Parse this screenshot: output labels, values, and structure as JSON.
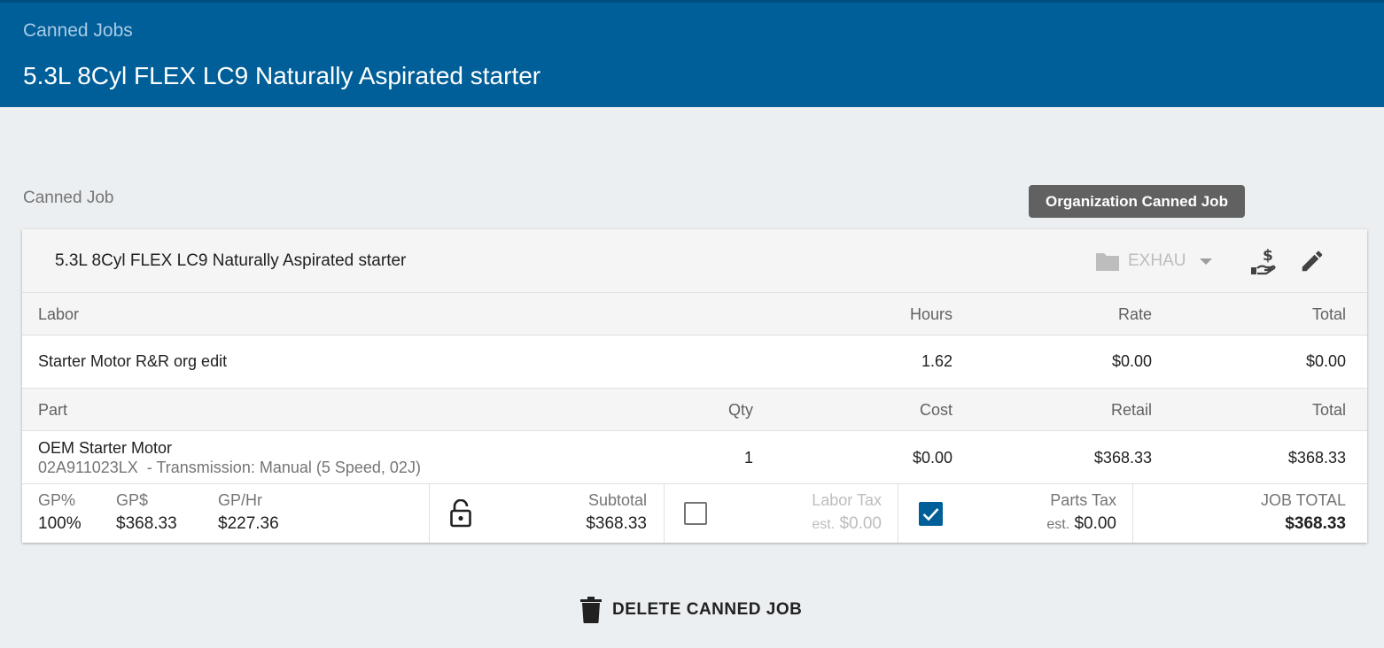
{
  "header": {
    "breadcrumb": "Canned Jobs",
    "title": "5.3L 8Cyl FLEX LC9 Naturally Aspirated starter"
  },
  "section_label": "Canned Job",
  "tooltip": "Organization Canned Job",
  "card": {
    "job_name": "5.3L 8Cyl FLEX LC9 Naturally Aspirated starter",
    "category": "EXHAU",
    "icons": [
      "folder-icon",
      "caret-down-icon",
      "pricing-hand-dollar-icon",
      "edit-pencil-icon"
    ]
  },
  "labor": {
    "headers": {
      "name": "Labor",
      "hours": "Hours",
      "rate": "Rate",
      "total": "Total"
    },
    "rows": [
      {
        "name": "Starter Motor R&R org edit",
        "hours": "1.62",
        "rate": "$0.00",
        "total": "$0.00"
      }
    ]
  },
  "parts": {
    "headers": {
      "name": "Part",
      "qty": "Qty",
      "cost": "Cost",
      "retail": "Retail",
      "total": "Total"
    },
    "rows": [
      {
        "name": "OEM Starter Motor",
        "number": "02A911023LX",
        "desc": "- Transmission: Manual (5 Speed, 02J)",
        "qty": "1",
        "cost": "$0.00",
        "retail": "$368.33",
        "total": "$368.33"
      }
    ]
  },
  "summary": {
    "gp_pct_label": "GP%",
    "gp_pct": "100%",
    "gp_dollar_label": "GP$",
    "gp_dollar": "$368.33",
    "gp_hr_label": "GP/Hr",
    "gp_hr": "$227.36",
    "subtotal_label": "Subtotal",
    "subtotal": "$368.33",
    "labor_tax_label": "Labor Tax",
    "labor_tax_est": "est.",
    "labor_tax": "$0.00",
    "labor_tax_checked": false,
    "parts_tax_label": "Parts Tax",
    "parts_tax_est": "est.",
    "parts_tax": "$0.00",
    "parts_tax_checked": true,
    "job_total_label": "JOB TOTAL",
    "job_total": "$368.33",
    "lock_state": "unlocked"
  },
  "delete_label": "DELETE CANNED JOB",
  "colors": {
    "header_bg": "#005f99",
    "checkbox_checked": "#005f99",
    "tooltip_bg": "#616161"
  }
}
